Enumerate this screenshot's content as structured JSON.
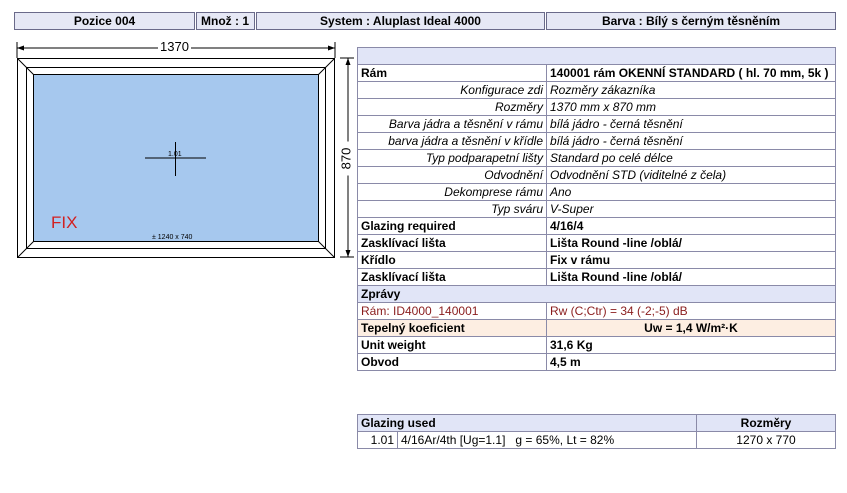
{
  "header": {
    "position": "Pozice 004",
    "quantity": "Množ : 1",
    "system": "System : Aluplast Ideal 4000",
    "color": "Barva : Bílý s černým těsněním"
  },
  "drawing": {
    "width_dim": "1370",
    "height_dim": "870",
    "sash_label": "FIX",
    "glass_size": "± 1240 x 740",
    "glass_id": "1.01",
    "glass_color": "#a6c8ee",
    "fix_color": "#d22020"
  },
  "spec": {
    "frame_label": "Rám",
    "frame_value": "140001 rám OKENNÍ STANDARD ( hl. 70 mm, 5k )",
    "details": [
      {
        "label": "Konfigurace zdi",
        "value": "Rozměry zákazníka"
      },
      {
        "label": "Rozměry",
        "value": "1370 mm x 870 mm"
      },
      {
        "label": "Barva jádra a těsnění v rámu",
        "value": "bílá jádro - černá těsnění"
      },
      {
        "label": "barva jádra a těsnění v křídle",
        "value": "bílá jádro - černá těsnění"
      },
      {
        "label": "Typ podparapetní lišty",
        "value": "Standard po celé délce"
      },
      {
        "label": "Odvodnění",
        "value": "Odvodnění STD (viditelné z čela)"
      },
      {
        "label": "Dekomprese rámu",
        "value": "Ano"
      },
      {
        "label": "Typ sváru",
        "value": "V-Super"
      }
    ],
    "glazing_required_label": "Glazing required",
    "glazing_required_value": "4/16/4",
    "bead1_label": "Zasklívací lišta",
    "bead1_value": "Lišta Round -line /oblá/",
    "sash_label": "Křídlo",
    "sash_value": "Fix v rámu",
    "bead2_label": "Zasklívací lišta",
    "bead2_value": "Lišta Round -line /oblá/",
    "messages_label": "Zprávy",
    "msg_left": "Rám: ID4000_140001",
    "msg_right": "Rw (C;Ctr) = 34 (-2;-5) dB",
    "thermal_label": "Tepelný koeficient",
    "thermal_value": "Uw = 1,4 W/m²·K",
    "weight_label": "Unit weight",
    "weight_value": "31,6 Kg",
    "perimeter_label": "Obvod",
    "perimeter_value": "4,5 m"
  },
  "glazing_used": {
    "header_label": "Glazing used",
    "header_size": "Rozměry",
    "rows": [
      {
        "id": "1.01",
        "desc": "4/16Ar/4th [Ug=1.1]   g = 65%, Lt = 82%",
        "size": "1270 x 770"
      }
    ]
  }
}
